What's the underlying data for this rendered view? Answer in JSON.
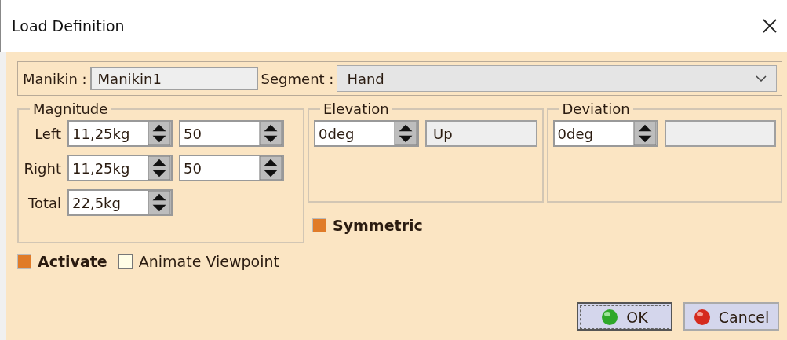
{
  "window": {
    "title": "Load Definition"
  },
  "manikin": {
    "label": "Manikin :",
    "value": "Manikin1"
  },
  "segment": {
    "label": "Segment :",
    "value": "Hand"
  },
  "magnitude": {
    "title": "Magnitude",
    "rows": [
      {
        "label": "Left",
        "value": "11,25kg",
        "percent": "50"
      },
      {
        "label": "Right",
        "value": "11,25kg",
        "percent": "50"
      },
      {
        "label": "Total",
        "value": "22,5kg"
      }
    ]
  },
  "elevation": {
    "title": "Elevation",
    "value": "0deg",
    "direction": "Up"
  },
  "deviation": {
    "title": "Deviation",
    "value": "0deg"
  },
  "symmetric": {
    "label": "Symmetric",
    "checked": true
  },
  "options": [
    {
      "label": "Activate",
      "checked": true,
      "bold": true
    },
    {
      "label": "Animate Viewpoint",
      "checked": false,
      "bold": false
    }
  ],
  "buttons": [
    {
      "label": "OK",
      "kind": "ok",
      "focused": true
    },
    {
      "label": "Cancel",
      "kind": "cancel",
      "focused": false
    }
  ]
}
